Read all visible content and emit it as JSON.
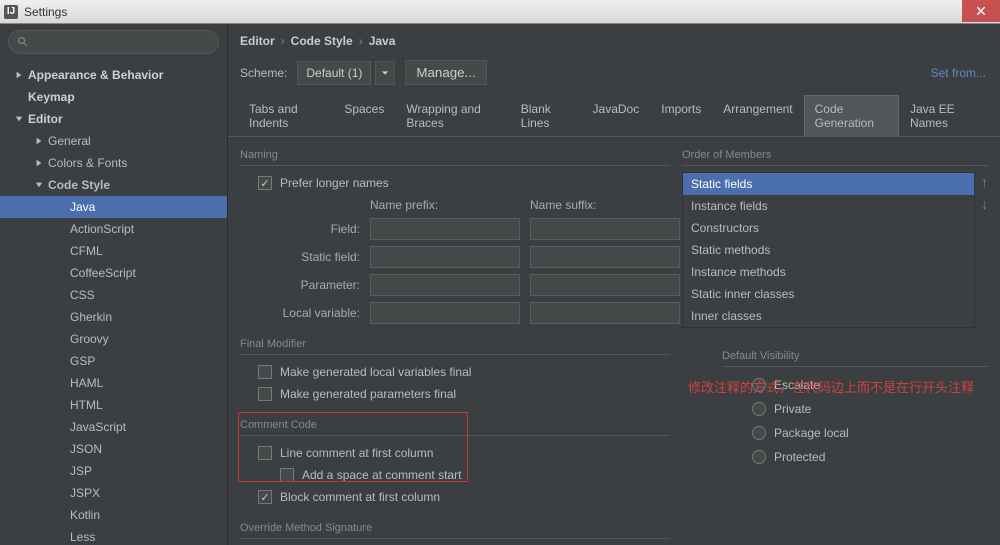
{
  "window": {
    "title": "Settings"
  },
  "sidebar": {
    "items": [
      {
        "label": "Appearance & Behavior",
        "depth": 1,
        "arrow": "right"
      },
      {
        "label": "Keymap",
        "depth": 1,
        "arrow": ""
      },
      {
        "label": "Editor",
        "depth": 1,
        "arrow": "down",
        "bold": true
      },
      {
        "label": "General",
        "depth": 2,
        "arrow": "right"
      },
      {
        "label": "Colors & Fonts",
        "depth": 2,
        "arrow": "right"
      },
      {
        "label": "Code Style",
        "depth": 2,
        "arrow": "down",
        "bold": true
      },
      {
        "label": "Java",
        "depth": 3,
        "selected": true
      },
      {
        "label": "ActionScript",
        "depth": 3
      },
      {
        "label": "CFML",
        "depth": 3
      },
      {
        "label": "CoffeeScript",
        "depth": 3
      },
      {
        "label": "CSS",
        "depth": 3
      },
      {
        "label": "Gherkin",
        "depth": 3
      },
      {
        "label": "Groovy",
        "depth": 3
      },
      {
        "label": "GSP",
        "depth": 3
      },
      {
        "label": "HAML",
        "depth": 3
      },
      {
        "label": "HTML",
        "depth": 3
      },
      {
        "label": "JavaScript",
        "depth": 3
      },
      {
        "label": "JSON",
        "depth": 3
      },
      {
        "label": "JSP",
        "depth": 3
      },
      {
        "label": "JSPX",
        "depth": 3
      },
      {
        "label": "Kotlin",
        "depth": 3
      },
      {
        "label": "Less",
        "depth": 3
      }
    ]
  },
  "breadcrumb": {
    "a": "Editor",
    "b": "Code Style",
    "c": "Java"
  },
  "scheme": {
    "label": "Scheme:",
    "value": "Default (1)",
    "manage": "Manage...",
    "setfrom": "Set from..."
  },
  "tabs": [
    "Tabs and Indents",
    "Spaces",
    "Wrapping and Braces",
    "Blank Lines",
    "JavaDoc",
    "Imports",
    "Arrangement",
    "Code Generation",
    "Java EE Names"
  ],
  "active_tab": 7,
  "naming": {
    "title": "Naming",
    "prefer": "Prefer longer names",
    "h_prefix": "Name prefix:",
    "h_suffix": "Name suffix:",
    "rows": [
      "Field:",
      "Static field:",
      "Parameter:",
      "Local variable:"
    ]
  },
  "final_modifier": {
    "title": "Final Modifier",
    "opt1": "Make generated local variables final",
    "opt2": "Make generated parameters final"
  },
  "comment_code": {
    "title": "Comment Code",
    "opt1": "Line comment at first column",
    "opt2": "Add a space at comment start",
    "opt3": "Block comment at first column"
  },
  "override": {
    "title": "Override Method Signature"
  },
  "order": {
    "title": "Order of Members",
    "items": [
      "Static fields",
      "Instance fields",
      "Constructors",
      "Static methods",
      "Instance methods",
      "Static inner classes",
      "Inner classes"
    ],
    "selected": 0
  },
  "visibility": {
    "title": "Default Visibility",
    "items": [
      "Escalate",
      "Private",
      "Package local",
      "Protected"
    ]
  },
  "annotation": "修改注释的方式，在代码边上而不是在行开头注释"
}
